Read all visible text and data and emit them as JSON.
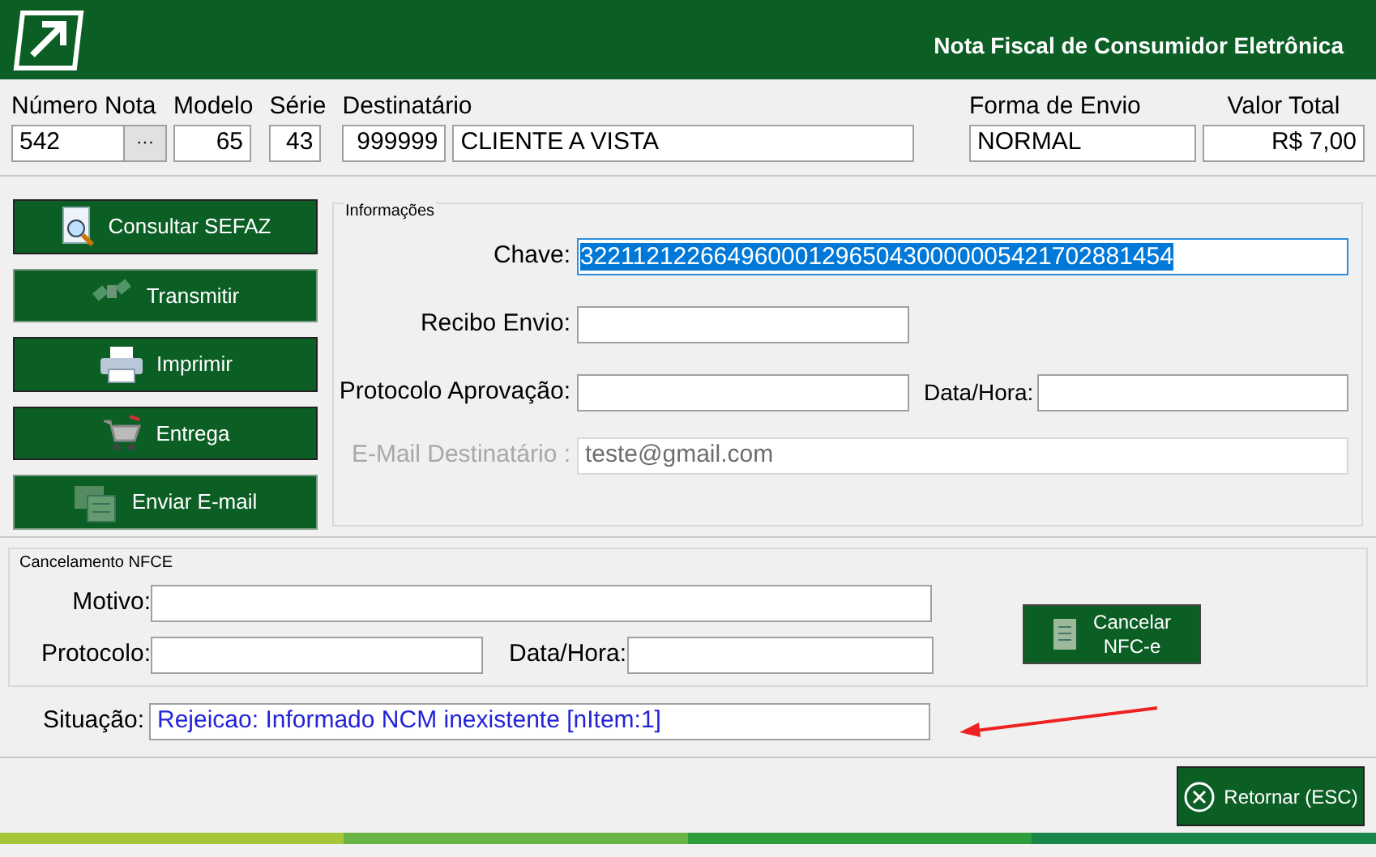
{
  "window": {
    "title": "Nota Fiscal de Consumidor Eletrônica"
  },
  "header": {
    "fields": [
      {
        "label": "Número Nota",
        "value": "542",
        "button": "···"
      },
      {
        "label": "Modelo",
        "value": "65"
      },
      {
        "label": "Série",
        "value": "43"
      },
      {
        "label": "Destinatário",
        "value": "999999",
        "name": "CLIENTE A VISTA"
      },
      {
        "label": "Forma de Envio",
        "value": "NORMAL"
      },
      {
        "label": "Valor Total",
        "value": "R$ 7,00"
      }
    ]
  },
  "actions": [
    {
      "label": "Consultar SEFAZ",
      "kind": "search",
      "disabled": false
    },
    {
      "label": "Transmitir",
      "kind": "satellite",
      "disabled": true
    },
    {
      "label": "Imprimir",
      "kind": "printer",
      "disabled": false
    },
    {
      "label": "Entrega",
      "kind": "cart",
      "disabled": false
    },
    {
      "label": "Enviar E-mail",
      "kind": "mail",
      "disabled": true
    }
  ],
  "info": {
    "title": "Informações",
    "chave_label": "Chave:",
    "chave": "32211212266496000129650430000005421702881454",
    "recibo_label": "Recibo Envio:",
    "protocolo_label": "Protocolo Aprovação:",
    "data_label": "Data/Hora:",
    "email_label": "E-Mail Destinatário :",
    "email": "teste@gmail.com",
    "email_disabled": true
  },
  "cancel": {
    "title": "Cancelamento NFCE",
    "motivo_label": "Motivo:",
    "protocolo_label": "Protocolo:",
    "data_label": "Data/Hora:",
    "button": [
      "Cancelar",
      "NFC-e"
    ]
  },
  "status": {
    "label": "Situação:",
    "value": "Rejeicao: Informado NCM inexistente [nItem:1]"
  },
  "footer": {
    "button": "Retornar (ESC)"
  }
}
